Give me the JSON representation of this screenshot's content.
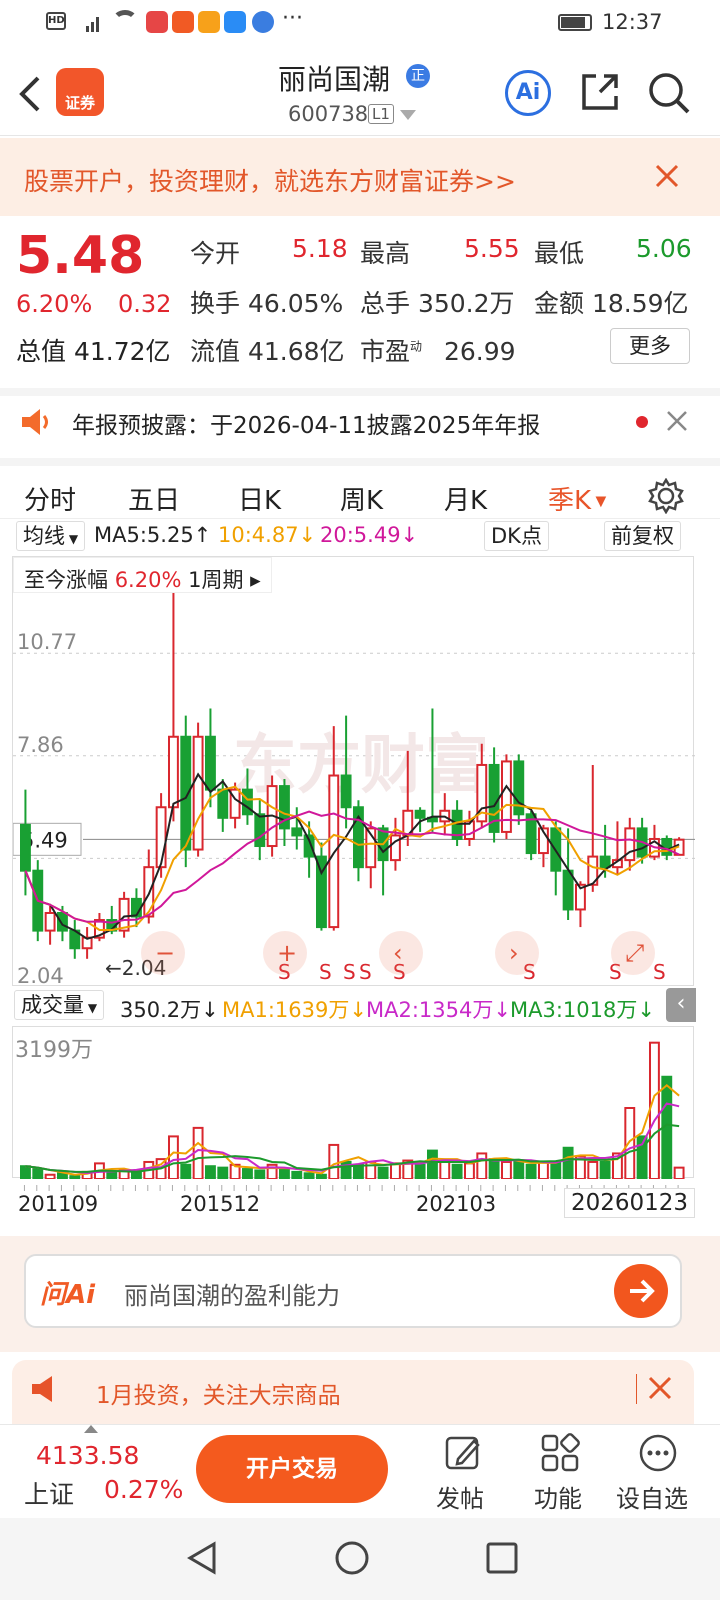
{
  "status": {
    "left_icons": [
      "hd-icon",
      "4g-signal-icon",
      "wifi-icon",
      "app-icon-1",
      "app-icon-2",
      "video-app-icon",
      "search-app-icon",
      "browser-app-icon"
    ],
    "more": "···",
    "time": "12:37"
  },
  "header": {
    "title": "丽尚国潮",
    "badge": "正",
    "code": "600738",
    "level": "L1",
    "logo_text": "证券",
    "ai_label": "Ai"
  },
  "banner": {
    "text": "股票开户，投资理财，就选东方财富证券>>"
  },
  "quote": {
    "price": "5.48",
    "pct": "6.20%",
    "chg": "0.32",
    "open_label": "今开",
    "open": "5.18",
    "high_label": "最高",
    "high": "5.55",
    "low_label": "最低",
    "low": "5.06",
    "turnover_label": "换手",
    "turnover": "46.05%",
    "vol_label": "总手",
    "vol": "350.2万",
    "amt_label": "金额",
    "amt": "18.59亿",
    "mcap_label": "总值",
    "mcap": "41.72亿",
    "float_label": "流值",
    "float": "41.68亿",
    "pe_label": "市盈",
    "pe_sup": "动",
    "pe": "26.99",
    "more": "更多"
  },
  "notice": {
    "text": "年报预披露：于2026-04-11披露2025年年报"
  },
  "tabs": [
    "分时",
    "五日",
    "日K",
    "周K",
    "月K",
    "季K"
  ],
  "chart": {
    "ma_type": "均线",
    "ma5": "MA5:5.25↑",
    "ma10": "10:4.87↓",
    "ma20": "20:5.49↓",
    "dk": "DK点",
    "fq": "前复权",
    "range_label": "至今涨幅",
    "range_pct": "6.20%",
    "range_period": "1周期",
    "y_labels": [
      "10.77",
      "7.86",
      "5.49",
      "2.04"
    ],
    "current_price_tag": "5.49",
    "low_mark": "2.04",
    "watermark": "东方财富",
    "s_marker": "S",
    "vol_title": "成交量",
    "vol_value": "350.2万↓",
    "vma1": "MA1:1639万↓",
    "vma2": "MA2:1354万↓",
    "vma3": "MA3:1018万↓",
    "vol_max": "3199万",
    "x_labels": [
      "201109",
      "201512",
      "202103",
      "20260123"
    ],
    "colors": {
      "up": "#d9272e",
      "down": "#19a033",
      "ma5": "#222222",
      "ma10": "#f0a000",
      "ma20": "#d0189a"
    }
  },
  "ask": {
    "logo": "问Ai",
    "placeholder": "丽尚国潮的盈利能力"
  },
  "promo": {
    "text": "1月投资，关注大宗商品"
  },
  "bottom": {
    "index_value": "4133.58",
    "index_name": "上证",
    "index_pct": "0.27%",
    "trade": "开户交易",
    "post": "发帖",
    "func": "功能",
    "fav": "设自选"
  }
}
